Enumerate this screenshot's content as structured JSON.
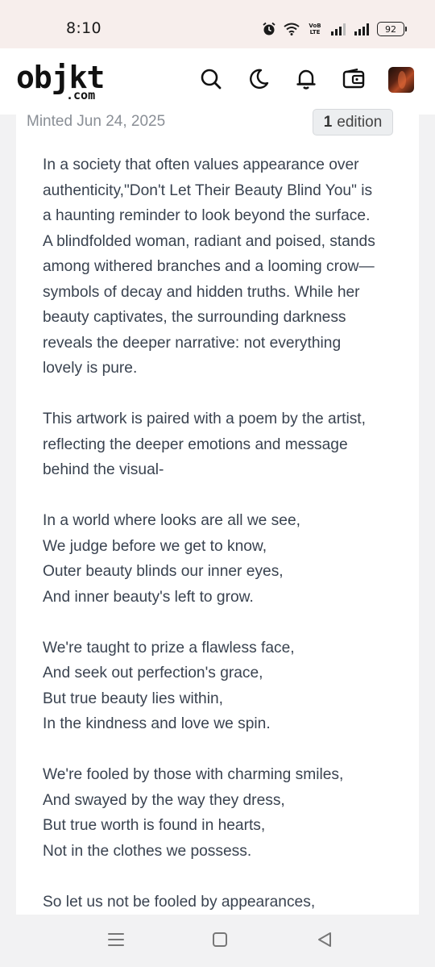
{
  "status_bar": {
    "time": "8:10",
    "network_label_top": "VoB",
    "network_label_bottom": "LTE",
    "battery": "92",
    "icons": [
      "alarm-icon",
      "wifi-icon",
      "signal-icon",
      "signal-icon",
      "battery-icon"
    ]
  },
  "header": {
    "logo_main": "objkt",
    "logo_sub": ".com",
    "icons": [
      "search-icon",
      "moon-icon",
      "bell-icon",
      "wallet-icon",
      "avatar"
    ]
  },
  "token": {
    "minted": "Minted Jun 24, 2025",
    "edition_count": "1",
    "edition_label": "edition"
  },
  "description": {
    "paragraphs": [
      [
        "In a society that often values appearance over",
        "authenticity,\"Don't Let Their Beauty Blind You\" is",
        "a haunting reminder to look beyond the surface.",
        "A blindfolded woman, radiant and poised, stands",
        "among withered branches and a looming crow—",
        "symbols of decay and hidden truths. While her",
        "beauty captivates, the surrounding darkness",
        "reveals the deeper narrative: not everything",
        "lovely is pure."
      ],
      [
        "This artwork is paired with a poem by the artist,",
        "reflecting the deeper emotions and message",
        "behind the visual-"
      ],
      [
        "In a world where looks are all we see,",
        "We judge before we get to know,",
        "Outer beauty blinds our inner eyes,",
        "And inner beauty's left to grow."
      ],
      [
        "We're taught to prize a flawless face,",
        "And seek out perfection's grace,",
        "But true beauty lies within,",
        "In the kindness and love we spin."
      ],
      [
        "We're fooled by those with charming smiles,",
        "And swayed by the way they dress,",
        "But true worth is found in hearts,",
        "Not in the clothes we possess."
      ],
      [
        "So let us not be fooled by appearances,"
      ]
    ]
  },
  "system_nav": {
    "icons": [
      "menu-icon",
      "home-square-icon",
      "back-triangle-icon"
    ]
  }
}
